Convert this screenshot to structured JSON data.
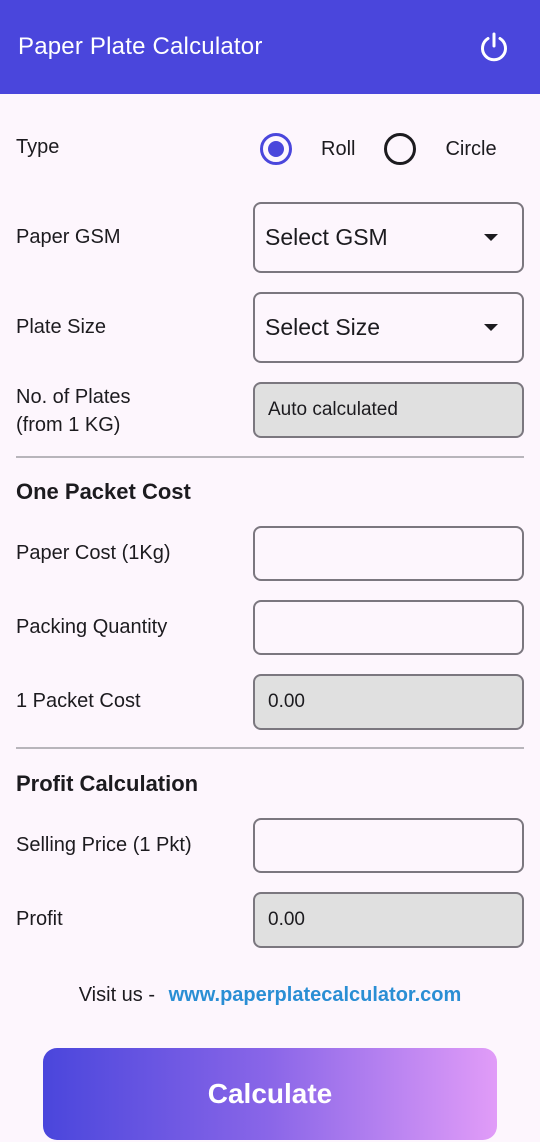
{
  "appbar": {
    "title": "Paper Plate Calculator",
    "power_icon": "power-icon"
  },
  "type": {
    "label": "Type",
    "options": [
      "Roll",
      "Circle"
    ],
    "selected": "Roll"
  },
  "gsm": {
    "label": "Paper GSM",
    "value": "Select GSM"
  },
  "plate_size": {
    "label": "Plate Size",
    "value": "Select Size"
  },
  "plates": {
    "label_line1": "No. of Plates",
    "label_line2": "(from 1 KG)",
    "value": "Auto calculated"
  },
  "packet_section": {
    "title": "One Packet Cost",
    "paper_cost_label": "Paper Cost (1Kg)",
    "packing_qty_label": "Packing Quantity",
    "packet_cost_label": "1 Packet Cost",
    "packet_cost_value": "0.00"
  },
  "profit_section": {
    "title": "Profit Calculation",
    "selling_price_label": "Selling Price (1 Pkt)",
    "profit_label": "Profit",
    "profit_value": "0.00"
  },
  "footer": {
    "visit_text": "Visit us -",
    "link": "www.paperplatecalculator.com"
  },
  "calculate_button": "Calculate",
  "colors": {
    "primary": "#4a46dc",
    "link": "#2a8ed4",
    "background": "#fdf6fd"
  }
}
